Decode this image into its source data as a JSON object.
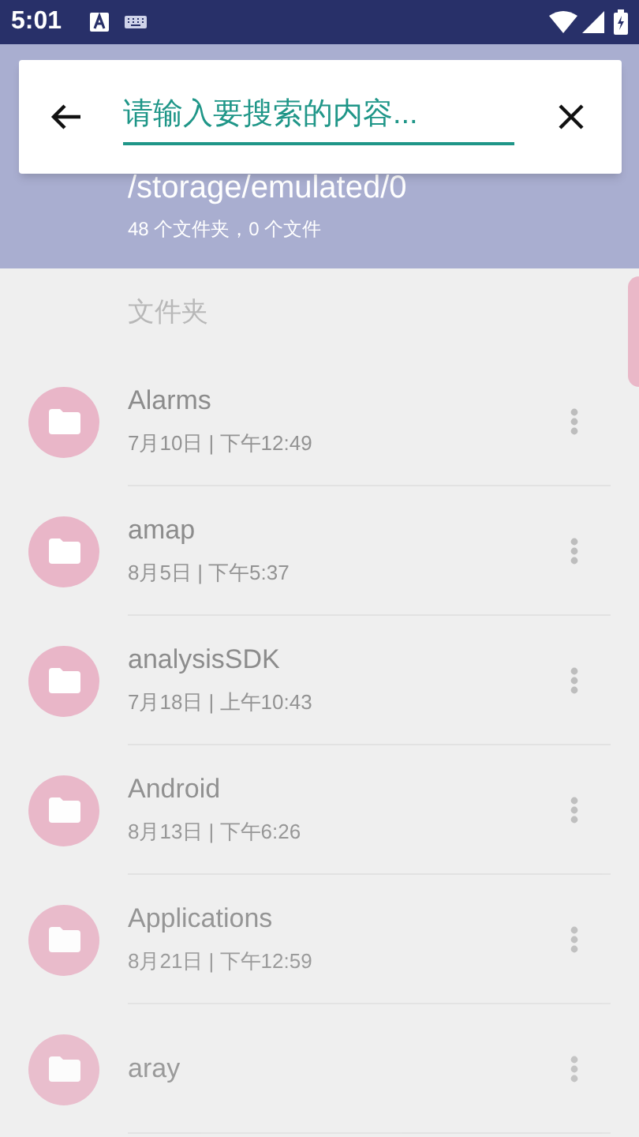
{
  "status_bar": {
    "time": "5:01"
  },
  "search": {
    "placeholder": "请输入要搜索的内容..."
  },
  "location": {
    "path": "/storage/emulated/0",
    "summary": "48 个文件夹，0 个文件"
  },
  "section_title": "文件夹",
  "folders": [
    {
      "name": "Alarms",
      "date": "7月10日 | 下午12:49"
    },
    {
      "name": "amap",
      "date": "8月5日 | 下午5:37"
    },
    {
      "name": "analysisSDK",
      "date": "7月18日 | 上午10:43"
    },
    {
      "name": "Android",
      "date": "8月13日 | 下午6:26"
    },
    {
      "name": "Applications",
      "date": "8月21日 | 下午12:59"
    },
    {
      "name": "aray"
    }
  ]
}
